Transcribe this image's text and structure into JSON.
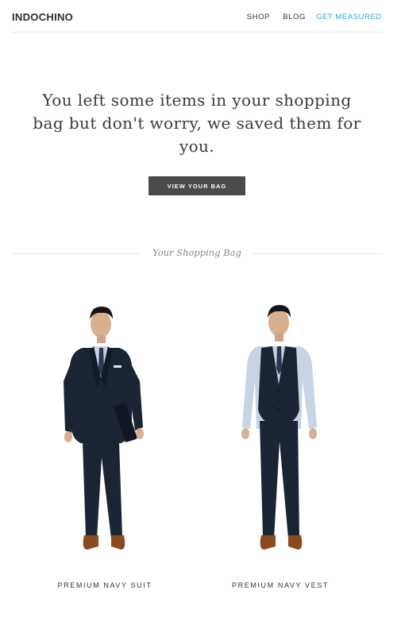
{
  "header": {
    "logo": "INDOCHINO",
    "nav": {
      "shop": "SHOP",
      "blog": "BLOG",
      "get_measured": "GET MEASURED"
    }
  },
  "hero": {
    "message": "You left some items in your shopping bag but don't worry, we saved them for you.",
    "cta_label": "VIEW YOUR BAG"
  },
  "bag": {
    "section_title": "Your Shopping Bag",
    "items": [
      {
        "name": "PREMIUM NAVY SUIT"
      },
      {
        "name": "PREMIUM NAVY VEST"
      }
    ]
  },
  "colors": {
    "accent_link": "#2aa6d6",
    "button_bg": "#4b4b4b",
    "navy": "#1b2433"
  }
}
